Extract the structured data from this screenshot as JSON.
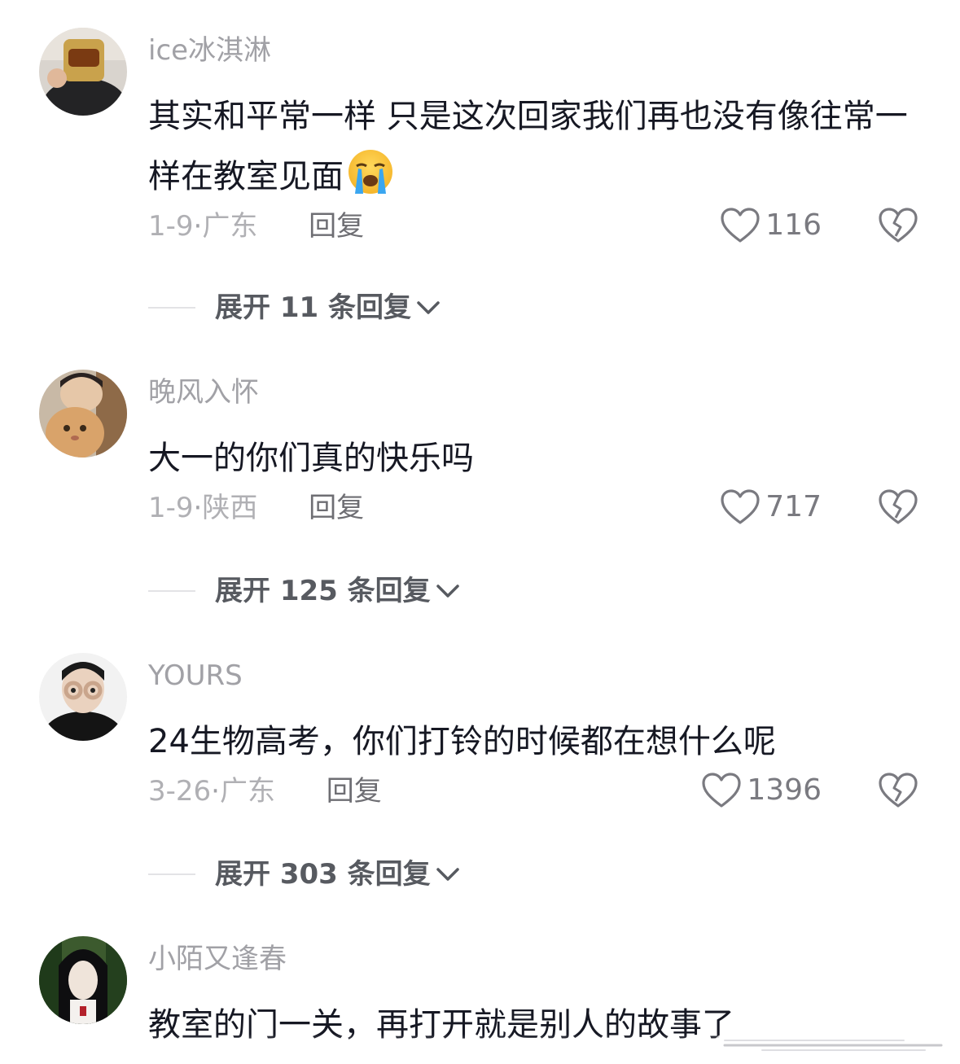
{
  "comments": [
    {
      "username": "ice冰淇淋",
      "text": "其实和平常一样 只是这次回家我们再也没有像往常一样在教室见面",
      "emoji": "loudly-crying-face-emoji",
      "date": "1-9",
      "location": "广东",
      "reply_label": "回复",
      "likes": "116",
      "expand_label": "展开 11 条回复"
    },
    {
      "username": "晚风入怀",
      "text": "大一的你们真的快乐吗",
      "date": "1-9",
      "location": "陕西",
      "reply_label": "回复",
      "likes": "717",
      "expand_label": "展开 125 条回复"
    },
    {
      "username": "YOURS",
      "text": "24生物高考，你们打铃的时候都在想什么呢",
      "date": "3-26",
      "location": "广东",
      "reply_label": "回复",
      "likes": "1396",
      "expand_label": "展开 303 条回复"
    },
    {
      "username": "小陌又逢春",
      "text": "教室的门一关，再打开就是别人的故事了"
    }
  ],
  "separator": "·",
  "icons": {
    "like": "heart-outline-icon",
    "dislike": "broken-heart-icon",
    "expand": "chevron-down-icon"
  },
  "colors": {
    "text_primary": "#161823",
    "text_secondary": "#a1a1a6",
    "expand_text": "#575a60"
  }
}
